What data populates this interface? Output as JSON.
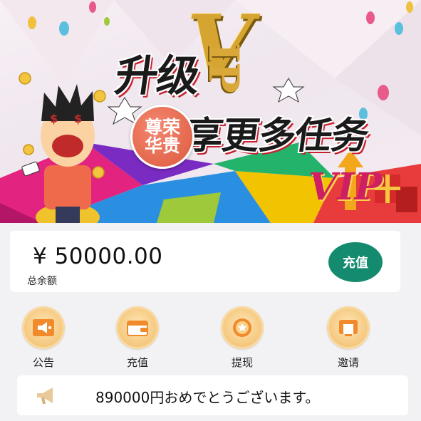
{
  "banner": {
    "title_line1": "升级",
    "vip_big": "V",
    "vip_small": "IP",
    "title_line2": "享更多任务",
    "badge_line1": "尊荣",
    "badge_line2": "华贵",
    "side_vip": "VIP"
  },
  "balance": {
    "amount": "¥ 50000.00",
    "label": "总余额",
    "recharge_button": "充值"
  },
  "actions": [
    {
      "label": "公告",
      "icon": "megaphone-icon"
    },
    {
      "label": "充值",
      "icon": "wallet-icon"
    },
    {
      "label": "提现",
      "icon": "medal-icon"
    },
    {
      "label": "邀请",
      "icon": "invite-icon"
    }
  ],
  "notice": {
    "text": "890000円おめでとうございます。",
    "icon": "megaphone-icon"
  },
  "colors": {
    "accent_green": "#148b6e",
    "icon_gold": "#f6cc85",
    "page_bg": "#f2f2f4"
  }
}
